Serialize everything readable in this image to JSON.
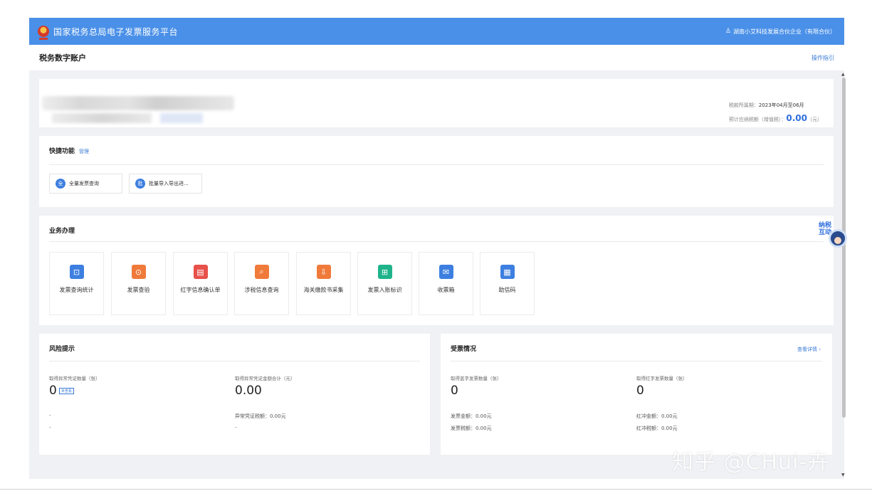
{
  "header": {
    "site_title": "国家税务总局电子发票服务平台",
    "user_name": "湖南小艾科技发展合伙企业（有限合伙）",
    "brand_color": "#4a90e8"
  },
  "subheader": {
    "page_title": "税务数字账户",
    "guide_link": "操作指引"
  },
  "account": {
    "period_label": "税款所属期：",
    "period_value": "2023年04月至06月",
    "estimate_label": "预计应纳税额（增值税）：",
    "estimate_value": "0.00",
    "estimate_unit": "（元）"
  },
  "quick": {
    "title": "快捷功能",
    "manage": "管理",
    "buttons": [
      {
        "icon_char": "全",
        "label": "全量发票查询"
      },
      {
        "icon_char": "批",
        "label": "批量导入导出进..."
      }
    ]
  },
  "business": {
    "title": "业务办理",
    "tiles": [
      {
        "label": "发票查询统计",
        "icon": "search-doc-icon",
        "color": "#3d7fe0",
        "glyph": "⊡"
      },
      {
        "label": "发票查验",
        "icon": "verify-icon",
        "color": "#f07a3a",
        "glyph": "⊙"
      },
      {
        "label": "红字信息确认单",
        "icon": "red-letter-icon",
        "color": "#e8504a",
        "glyph": "▤"
      },
      {
        "label": "涉税信息查询",
        "icon": "tax-info-icon",
        "color": "#f07a3a",
        "glyph": "⌕"
      },
      {
        "label": "海关缴款书采集",
        "icon": "customs-icon",
        "color": "#f07a3a",
        "glyph": "⇩"
      },
      {
        "label": "发票入账标识",
        "icon": "entry-mark-icon",
        "color": "#1fb38a",
        "glyph": "⊞"
      },
      {
        "label": "收票箱",
        "icon": "inbox-icon",
        "color": "#3d7fe0",
        "glyph": "✉"
      },
      {
        "label": "助信码",
        "icon": "qr-code-icon",
        "color": "#3d7fe0",
        "glyph": "▦"
      }
    ]
  },
  "risk": {
    "title": "风险提示",
    "count_label": "取得异常凭证数量（张）",
    "count_value": "0",
    "unviewed_badge": "未查看",
    "amount_label": "取得异常凭证金额合计（元）",
    "amount_value": "0.00",
    "tax_line": "异常凭证税额：0.00元",
    "dash1": "-",
    "dash2": "-",
    "dash3": "-"
  },
  "ticket": {
    "title": "受票情况",
    "detail_link": "查看详情 ›",
    "blue_label": "取得蓝字发票数量（张）",
    "blue_value": "0",
    "blue_amount": "发票金额：0.00元",
    "blue_tax": "发票税额：0.00元",
    "red_label": "取得红字发票数量（张）",
    "red_value": "0",
    "red_amount": "红冲金额：0.00元",
    "red_tax": "红冲税额：0.00元"
  },
  "assistant": {
    "label": "纳税互动"
  },
  "watermark": "知乎 @CHui-卉"
}
